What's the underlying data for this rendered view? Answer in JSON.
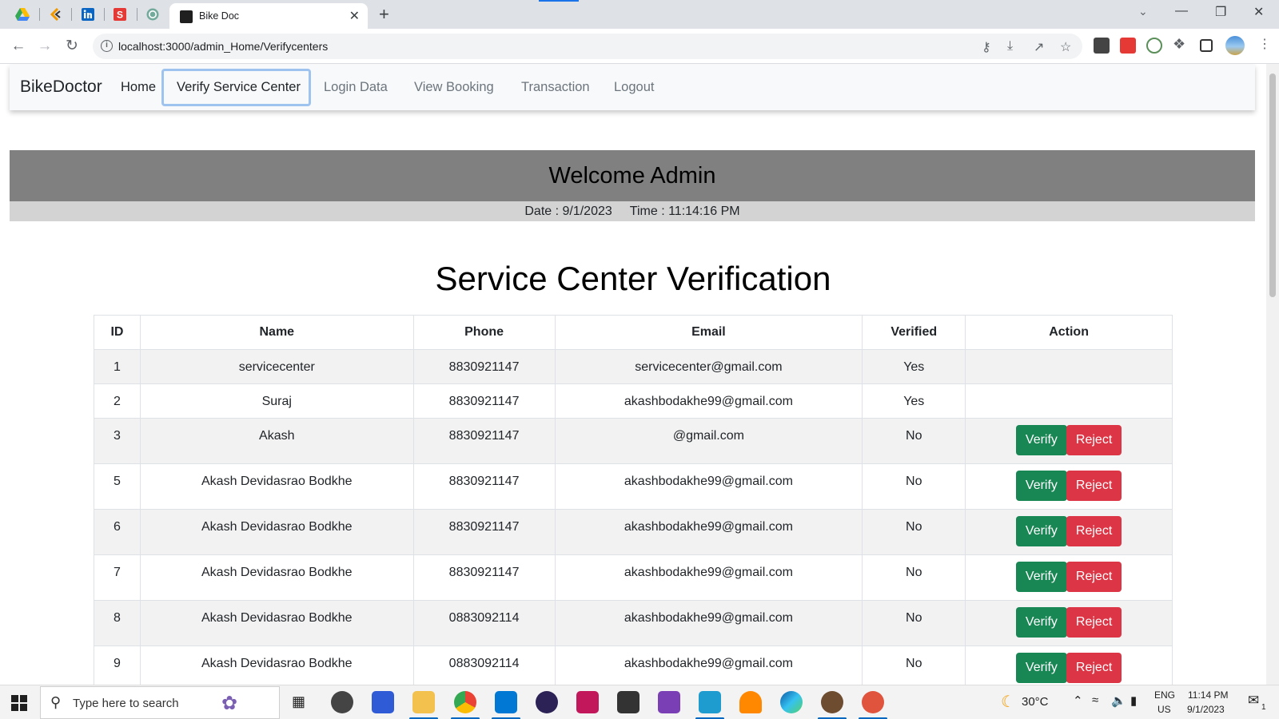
{
  "browser": {
    "active_tab_title": "Bike Doc",
    "new_tab_symbol": "+",
    "close_symbol": "✕",
    "url": "localhost:3000/admin_Home/Verifycenters"
  },
  "navbar": {
    "brand": "BikeDoctor",
    "links": [
      "Home",
      "Verify Service Center",
      "Login Data",
      "View Booking",
      "Transaction",
      "Logout"
    ]
  },
  "welcome": {
    "heading": "Welcome Admin",
    "date_text": "Date : 9/1/2023",
    "time_text": "Time : 11:14:16 PM"
  },
  "section_title": "Service Center Verification",
  "table": {
    "headers": [
      "ID",
      "Name",
      "Phone",
      "Email",
      "Verified",
      "Action"
    ],
    "rows": [
      {
        "id": "1",
        "name": "servicecenter",
        "phone": "8830921147",
        "email": "servicecenter@gmail.com",
        "verified": "Yes"
      },
      {
        "id": "2",
        "name": "Suraj",
        "phone": "8830921147",
        "email": "akashbodakhe99@gmail.com",
        "verified": "Yes"
      },
      {
        "id": "3",
        "name": "Akash",
        "phone": "8830921147",
        "email": "@gmail.com",
        "verified": "No"
      },
      {
        "id": "5",
        "name": "Akash Devidasrao Bodkhe",
        "phone": "8830921147",
        "email": "akashbodakhe99@gmail.com",
        "verified": "No"
      },
      {
        "id": "6",
        "name": "Akash Devidasrao Bodkhe",
        "phone": "8830921147",
        "email": "akashbodakhe99@gmail.com",
        "verified": "No"
      },
      {
        "id": "7",
        "name": "Akash Devidasrao Bodkhe",
        "phone": "8830921147",
        "email": "akashbodakhe99@gmail.com",
        "verified": "No"
      },
      {
        "id": "8",
        "name": "Akash Devidasrao Bodkhe",
        "phone": "0883092114",
        "email": "akashbodakhe99@gmail.com",
        "verified": "No"
      },
      {
        "id": "9",
        "name": "Akash Devidasrao Bodkhe",
        "phone": "0883092114",
        "email": "akashbodakhe99@gmail.com",
        "verified": "No"
      }
    ],
    "verify_label": "Verify",
    "reject_label": "Reject"
  },
  "taskbar": {
    "search_placeholder": "Type here to search",
    "weather": "30°C",
    "lang_1": "ENG",
    "lang_2": "US",
    "clock_time": "11:14 PM",
    "clock_date": "9/1/2023",
    "notification_count": "1"
  },
  "colors": {
    "verify_button": "#198754",
    "reject_button": "#dc3545",
    "welcome_bar": "#808080",
    "date_bar": "#d3d3d3"
  },
  "icons": [
    "google-drive-icon",
    "bookmark-app-icon",
    "linkedin-icon",
    "stack-app-icon",
    "chatgpt-icon",
    "password-key-icon",
    "install-icon",
    "share-icon",
    "star-icon",
    "extensions-icon",
    "profile-avatar"
  ]
}
